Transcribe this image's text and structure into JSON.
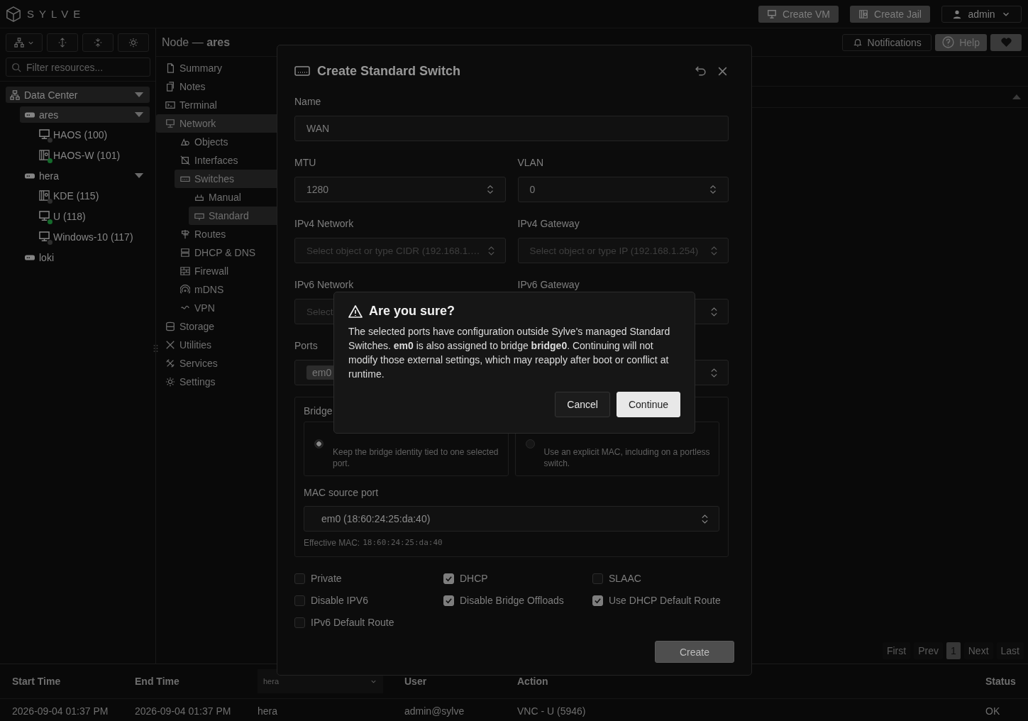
{
  "app": {
    "brand": "SYLVE"
  },
  "top_bar": {
    "buttons": [
      {
        "label": "Create VM",
        "kind": "vm"
      },
      {
        "label": "Create Jail",
        "kind": "jail"
      }
    ],
    "user_menu": {
      "label": "admin"
    }
  },
  "sidebar": {
    "filter": {
      "placeholder": "Filter resources..."
    },
    "tree": [
      {
        "label": "Data Center",
        "kind": "datacenter",
        "highlighted": true,
        "expanded": true,
        "children": [
          {
            "label": "ares",
            "kind": "node",
            "highlighted": true,
            "expanded": true,
            "children": [
              {
                "label": "HAOS (100)",
                "kind": "vm",
                "running": false
              },
              {
                "label": "HAOS-W (101)",
                "kind": "jail",
                "running": true
              }
            ]
          },
          {
            "label": "hera",
            "kind": "node",
            "highlighted": false,
            "expanded": true,
            "children": [
              {
                "label": "KDE (115)",
                "kind": "jail",
                "running": false
              },
              {
                "label": "U (118)",
                "kind": "vm",
                "running": true
              },
              {
                "label": "Windows-10 (117)",
                "kind": "vm",
                "running": false
              }
            ]
          },
          {
            "label": "loki",
            "kind": "node",
            "highlighted": false
          }
        ]
      }
    ]
  },
  "header": {
    "title": "Node — **ares**",
    "buttons": [
      {
        "label": "Notifications",
        "kind": "notifications"
      },
      {
        "label": "Help",
        "kind": "help"
      },
      {
        "kind": "favorite"
      }
    ]
  },
  "node_menu": {
    "items": [
      {
        "label": "Summary",
        "highlighted": false
      },
      {
        "label": "Notes",
        "highlighted": false
      },
      {
        "label": "Terminal",
        "highlighted": false
      },
      {
        "label": "Network",
        "highlighted": true,
        "children": [
          {
            "label": "Objects",
            "highlighted": false
          },
          {
            "label": "Interfaces",
            "highlighted": false
          },
          {
            "label": "Switches",
            "highlighted": true,
            "children": [
              {
                "label": "Manual",
                "highlighted": false
              },
              {
                "label": "Standard",
                "highlighted": true
              }
            ]
          },
          {
            "label": "Routes",
            "highlighted": false
          },
          {
            "label": "DHCP & DNS",
            "highlighted": false
          },
          {
            "label": "Firewall",
            "highlighted": false
          },
          {
            "label": "mDNS",
            "highlighted": false
          },
          {
            "label": "VPN",
            "highlighted": false
          }
        ]
      },
      {
        "label": "Storage",
        "highlighted": false
      },
      {
        "label": "Utilities",
        "highlighted": false
      },
      {
        "label": "Services",
        "highlighted": false
      },
      {
        "label": "Settings",
        "highlighted": false
      }
    ]
  },
  "pagination": [
    {
      "label": "First",
      "selected": false
    },
    {
      "label": "Prev",
      "selected": false
    },
    {
      "label": "1",
      "selected": true
    },
    {
      "label": "Next",
      "selected": false
    },
    {
      "label": "Last",
      "selected": false
    }
  ],
  "log_table": {
    "columns": [
      {
        "kind": "text",
        "label": "Start Time"
      },
      {
        "kind": "text",
        "label": "End Time"
      },
      {
        "kind": "filter",
        "value": "hera"
      },
      {
        "kind": "text",
        "label": "User"
      },
      {
        "kind": "text",
        "label": "Action"
      },
      {
        "kind": "text",
        "label": "Status"
      }
    ],
    "rows": [
      [
        "2026-09-04 01:37 PM",
        "2026-09-04 01:37 PM",
        "hera",
        "admin@sylve",
        "VNC - U (5946)",
        "OK"
      ]
    ]
  },
  "modal": {
    "title": "Create Standard Switch",
    "name": {
      "label": "Name",
      "value": "WAN"
    },
    "mtu": {
      "label": "MTU",
      "value": "1280"
    },
    "vlan": {
      "label": "VLAN",
      "value": "0"
    },
    "ipv4_network": {
      "label": "IPv4 Network",
      "placeholder": "Select object or type CIDR (192.168.1.…"
    },
    "ipv4_gateway": {
      "label": "IPv4 Gateway",
      "placeholder": "Select object or type IP (192.168.1.254)"
    },
    "ipv6_network": {
      "label": "IPv6 Network",
      "placeholder": "Select"
    },
    "ipv6_gateway": {
      "label": "IPv6 Gateway"
    },
    "ports": {
      "label": "Ports",
      "chips": [
        "em0"
      ]
    },
    "bridge": {
      "label": "Bridge",
      "options": [
        {
          "description": "Keep the bridge identity tied to one selected port.",
          "selected": true
        },
        {
          "description": "Use an explicit MAC, including on a portless switch.",
          "selected": false
        }
      ],
      "mac_source_port": {
        "label": "MAC source port",
        "value": "em0 (18:60:24:25:da:40)"
      },
      "effective_mac": {
        "label": "Effective MAC:",
        "value": "18:60:24:25:da:40"
      }
    },
    "checkboxes": [
      {
        "label": "Private",
        "checked": false
      },
      {
        "label": "DHCP",
        "checked": true
      },
      {
        "label": "SLAAC",
        "checked": false
      },
      {
        "label": "Disable IPV6",
        "checked": false
      },
      {
        "label": "Disable Bridge Offloads",
        "checked": true
      },
      {
        "label": "Use DHCP Default Route",
        "checked": true
      },
      {
        "label": "IPv6 Default Route",
        "checked": false
      }
    ],
    "create_button": "Create"
  },
  "dialog": {
    "title": "Are you sure?",
    "message": "The selected ports have configuration outside Sylve's managed Standard Switches. **em0** is also assigned to bridge **bridge0**. Continuing will not modify those external settings, which may reapply after boot or conflict at runtime.",
    "buttons": [
      {
        "label": "Cancel",
        "kind": "secondary"
      },
      {
        "label": "Continue",
        "kind": "primary"
      }
    ]
  }
}
